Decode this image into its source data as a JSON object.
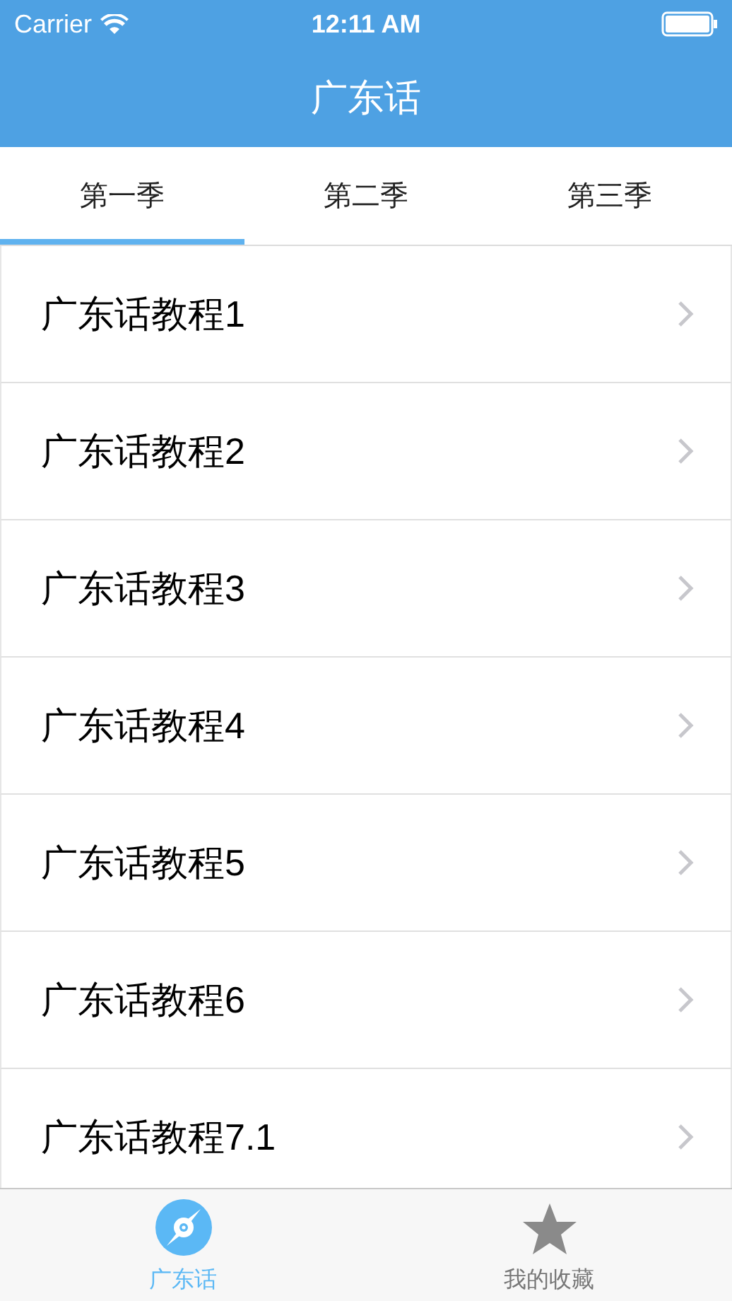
{
  "status_bar": {
    "carrier": "Carrier",
    "time": "12:11 AM"
  },
  "nav_bar": {
    "title": "广东话"
  },
  "tabs": [
    {
      "label": "第一季",
      "selected": true
    },
    {
      "label": "第二季",
      "selected": false
    },
    {
      "label": "第三季",
      "selected": false
    }
  ],
  "list": {
    "items": [
      "广东话教程1",
      "广东话教程2",
      "广东话教程3",
      "广东话教程4",
      "广东话教程5",
      "广东话教程6",
      "广东话教程7.1"
    ]
  },
  "tab_bar": [
    {
      "kind": "disc",
      "label": "广东话",
      "selected": true
    },
    {
      "kind": "star",
      "label": "我的收藏",
      "selected": false
    }
  ]
}
